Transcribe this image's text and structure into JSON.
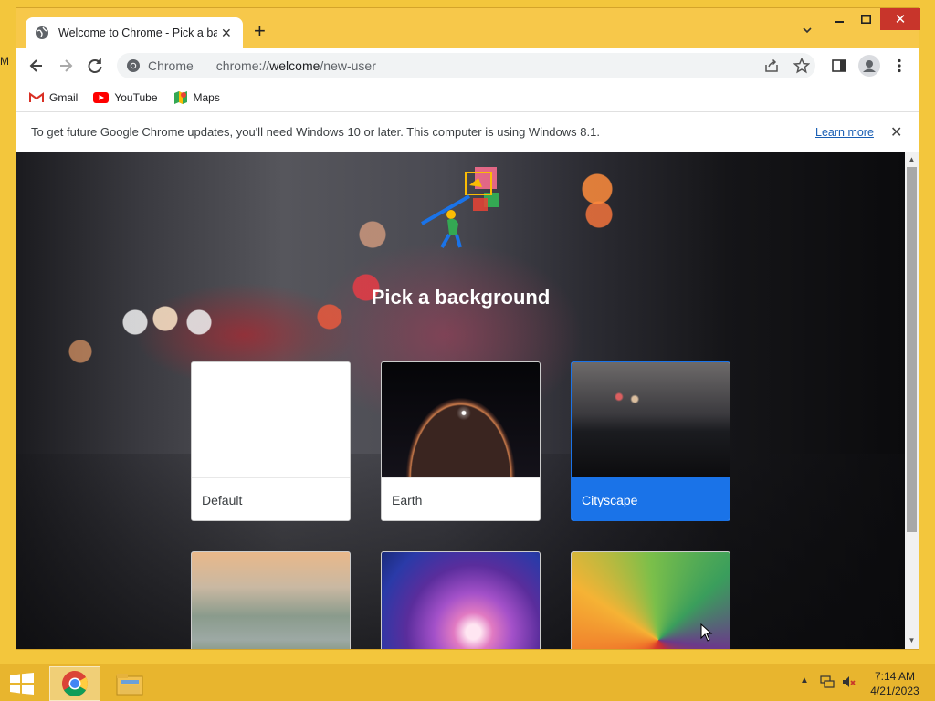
{
  "desktop": {
    "edge_text": "M"
  },
  "browser": {
    "tab": {
      "title": "Welcome to Chrome - Pick a background"
    },
    "omnibox": {
      "label": "Chrome",
      "url_host": "chrome://",
      "url_domain": "welcome",
      "url_path": "/new-user"
    },
    "bookmarks": [
      {
        "label": "Gmail",
        "icon": "gmail-icon"
      },
      {
        "label": "YouTube",
        "icon": "youtube-icon"
      },
      {
        "label": "Maps",
        "icon": "maps-icon"
      }
    ],
    "infobar": {
      "message": "To get future Google Chrome updates, you'll need Windows 10 or later. This computer is using Windows 8.1.",
      "link": "Learn more"
    }
  },
  "page": {
    "title": "Pick a background",
    "backgrounds": [
      {
        "label": "Default",
        "selected": false
      },
      {
        "label": "Earth",
        "selected": false
      },
      {
        "label": "Cityscape",
        "selected": true
      }
    ]
  },
  "taskbar": {
    "time": "7:14 AM",
    "date": "4/21/2023"
  },
  "colors": {
    "accent": "#1a73e8",
    "frame": "#f7c84a",
    "close": "#c8352b"
  }
}
